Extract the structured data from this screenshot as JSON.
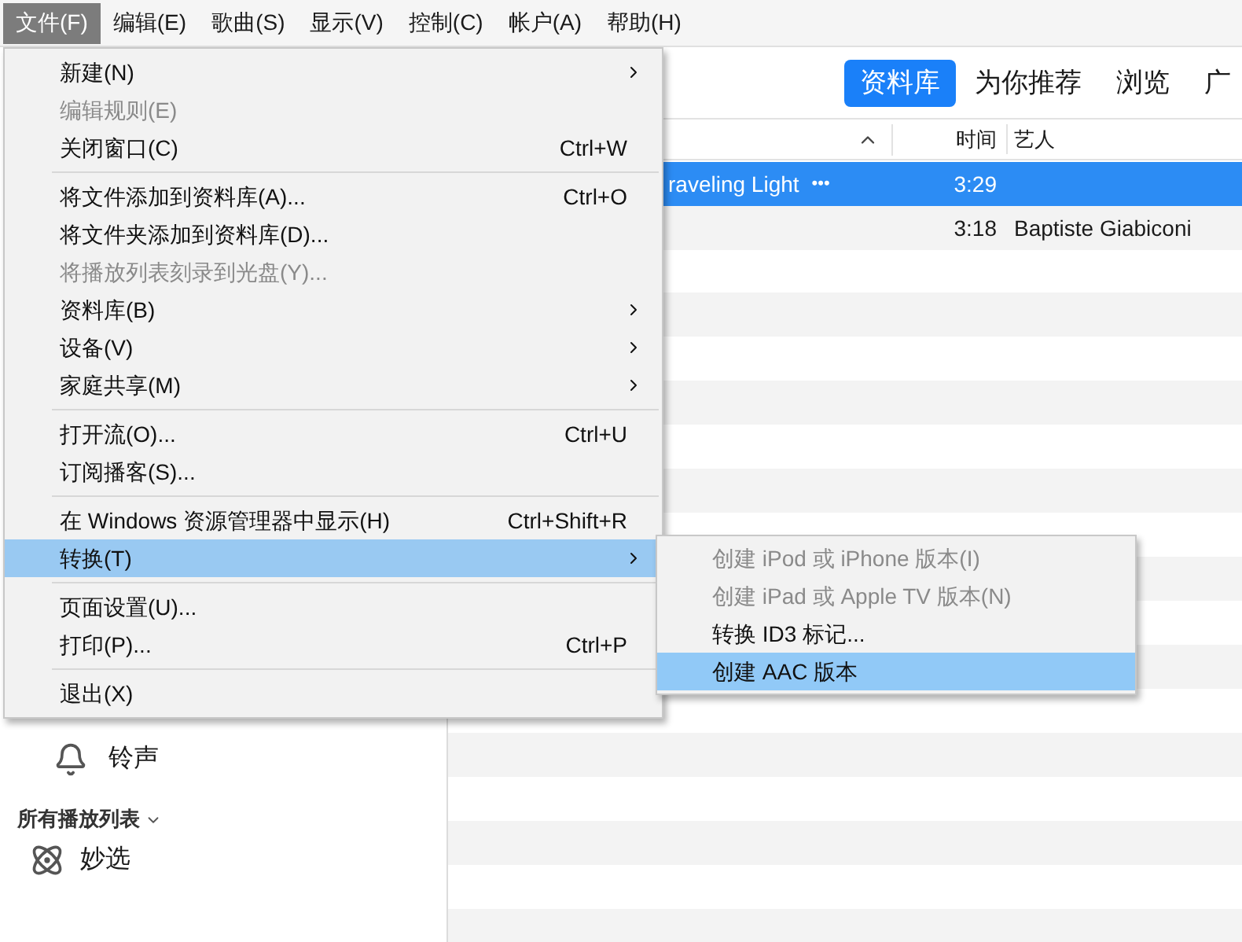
{
  "menubar": [
    {
      "label": "文件(F)",
      "selected": true
    },
    {
      "label": "编辑(E)",
      "selected": false
    },
    {
      "label": "歌曲(S)",
      "selected": false
    },
    {
      "label": "显示(V)",
      "selected": false
    },
    {
      "label": "控制(C)",
      "selected": false
    },
    {
      "label": "帐户(A)",
      "selected": false
    },
    {
      "label": "帮助(H)",
      "selected": false
    }
  ],
  "nav_tabs": [
    {
      "label": "资料库",
      "selected": true
    },
    {
      "label": "为你推荐",
      "selected": false
    },
    {
      "label": "浏览",
      "selected": false
    },
    {
      "label": "广",
      "selected": false
    }
  ],
  "table": {
    "columns": [
      {
        "label": "时间"
      },
      {
        "label": "艺人"
      }
    ],
    "rows": [
      {
        "title": "raveling Light",
        "more": "•••",
        "time": "3:29",
        "artist": "",
        "selected": true
      },
      {
        "title": "",
        "more": "",
        "time": "3:18",
        "artist": "Baptiste Giabiconi",
        "selected": false
      }
    ]
  },
  "sidebar": {
    "items": [
      {
        "label": "铃声",
        "kind": "bell"
      }
    ],
    "section": "所有播放列表",
    "playlists": [
      {
        "label": "妙选",
        "kind": "atom"
      }
    ]
  },
  "file_menu": [
    {
      "kind": "item",
      "label": "新建(N)",
      "submenu": true,
      "disabled": false,
      "selected": false
    },
    {
      "kind": "item",
      "label": "编辑规则(E)",
      "submenu": false,
      "disabled": true,
      "selected": false
    },
    {
      "kind": "item",
      "label": "关闭窗口(C)",
      "shortcut": "Ctrl+W",
      "submenu": false,
      "disabled": false,
      "selected": false
    },
    {
      "kind": "separator"
    },
    {
      "kind": "item",
      "label": "将文件添加到资料库(A)...",
      "shortcut": "Ctrl+O",
      "submenu": false,
      "disabled": false,
      "selected": false
    },
    {
      "kind": "item",
      "label": "将文件夹添加到资料库(D)...",
      "submenu": false,
      "disabled": false,
      "selected": false
    },
    {
      "kind": "item",
      "label": "将播放列表刻录到光盘(Y)...",
      "submenu": false,
      "disabled": true,
      "selected": false
    },
    {
      "kind": "item",
      "label": "资料库(B)",
      "submenu": true,
      "disabled": false,
      "selected": false
    },
    {
      "kind": "item",
      "label": "设备(V)",
      "submenu": true,
      "disabled": false,
      "selected": false
    },
    {
      "kind": "item",
      "label": "家庭共享(M)",
      "submenu": true,
      "disabled": false,
      "selected": false
    },
    {
      "kind": "separator"
    },
    {
      "kind": "item",
      "label": "打开流(O)...",
      "shortcut": "Ctrl+U",
      "submenu": false,
      "disabled": false,
      "selected": false
    },
    {
      "kind": "item",
      "label": "订阅播客(S)...",
      "submenu": false,
      "disabled": false,
      "selected": false
    },
    {
      "kind": "separator"
    },
    {
      "kind": "item",
      "label": "在 Windows 资源管理器中显示(H)",
      "shortcut": "Ctrl+Shift+R",
      "submenu": false,
      "disabled": false,
      "selected": false
    },
    {
      "kind": "item",
      "label": "转换(T)",
      "submenu": true,
      "disabled": false,
      "selected": true
    },
    {
      "kind": "separator"
    },
    {
      "kind": "item",
      "label": "页面设置(U)...",
      "submenu": false,
      "disabled": false,
      "selected": false
    },
    {
      "kind": "item",
      "label": "打印(P)...",
      "shortcut": "Ctrl+P",
      "submenu": false,
      "disabled": false,
      "selected": false
    },
    {
      "kind": "separator"
    },
    {
      "kind": "item",
      "label": "退出(X)",
      "submenu": false,
      "disabled": false,
      "selected": false
    }
  ],
  "convert_submenu": [
    {
      "label": "创建 iPod 或 iPhone 版本(I)",
      "disabled": true,
      "selected": false
    },
    {
      "label": "创建 iPad 或 Apple TV 版本(N)",
      "disabled": true,
      "selected": false
    },
    {
      "label": "转换 ID3 标记...",
      "disabled": false,
      "selected": false
    },
    {
      "label": "创建 AAC 版本",
      "disabled": false,
      "selected": true
    }
  ]
}
